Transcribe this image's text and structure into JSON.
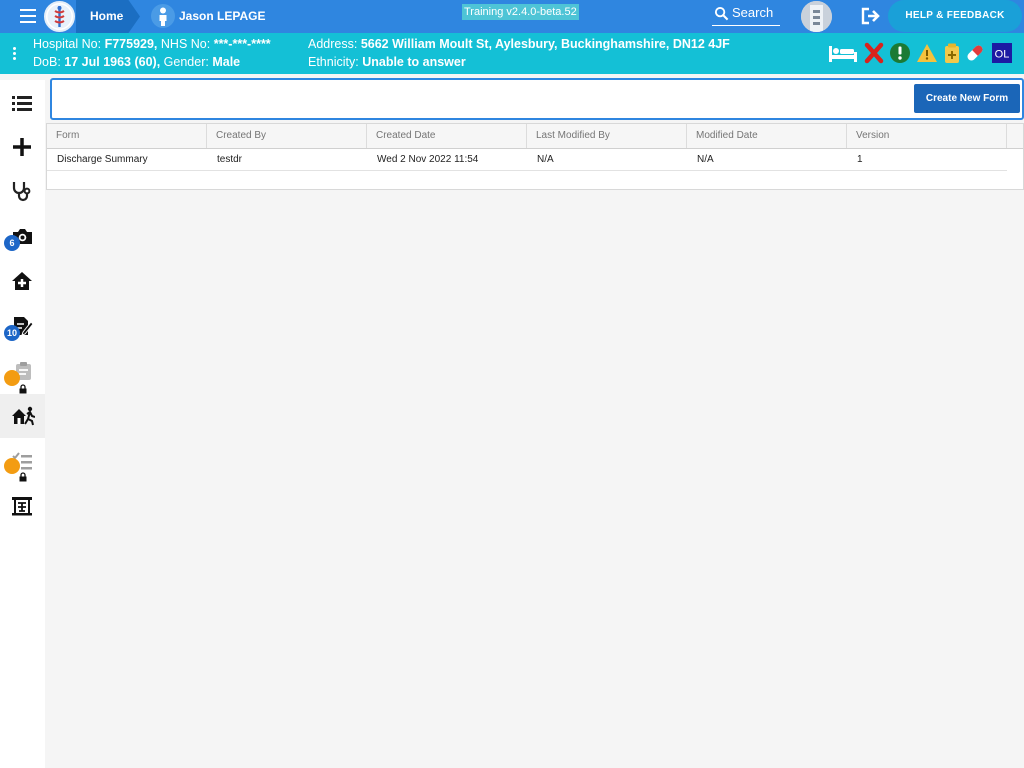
{
  "header": {
    "home_label": "Home",
    "patient_name": "Jason LEPAGE",
    "environment": "Training v2.4.0-beta.52",
    "search_label": "Search",
    "help_label": "HELP & FEEDBACK"
  },
  "banner": {
    "hospital_no_label": "Hospital No:",
    "hospital_no": "F775929,",
    "nhs_no_label": "NHS No:",
    "nhs_no": "***-***-****",
    "dob_label": "DoB:",
    "dob": "17 Jul 1963 (60),",
    "gender_label": "Gender:",
    "gender": "Male",
    "address_label": "Address:",
    "address": "5662 William Moult St, Aylesbury, Buckinghamshire, DN12 4JF",
    "ethnicity_label": "Ethnicity:",
    "ethnicity": "Unable to answer",
    "flags": {
      "ol_label": "OL"
    }
  },
  "sidenav": {
    "items": [
      {
        "name": "list"
      },
      {
        "name": "add"
      },
      {
        "name": "stethoscope"
      },
      {
        "name": "camera",
        "badge": "6"
      },
      {
        "name": "home-medical"
      },
      {
        "name": "edit-note",
        "badge": "10"
      },
      {
        "name": "clipboard-locked"
      },
      {
        "name": "discharge",
        "active": true
      },
      {
        "name": "checklist-locked"
      },
      {
        "name": "ward-board"
      }
    ]
  },
  "toolbar": {
    "create_label": "Create New Form"
  },
  "table": {
    "columns": [
      "Form",
      "Created By",
      "Created Date",
      "Last Modified By",
      "Modified Date",
      "Version"
    ],
    "rows": [
      [
        "Discharge Summary",
        "testdr",
        "Wed 2 Nov 2022 11:54",
        "N/A",
        "N/A",
        "1"
      ]
    ]
  },
  "colors": {
    "topbar": "#2f86e0",
    "banner": "#14c0d6",
    "help_button": "#1aa0d8",
    "primary_button": "#1b66b8",
    "badge_blue": "#1d66c7",
    "badge_orange": "#f39c12"
  }
}
